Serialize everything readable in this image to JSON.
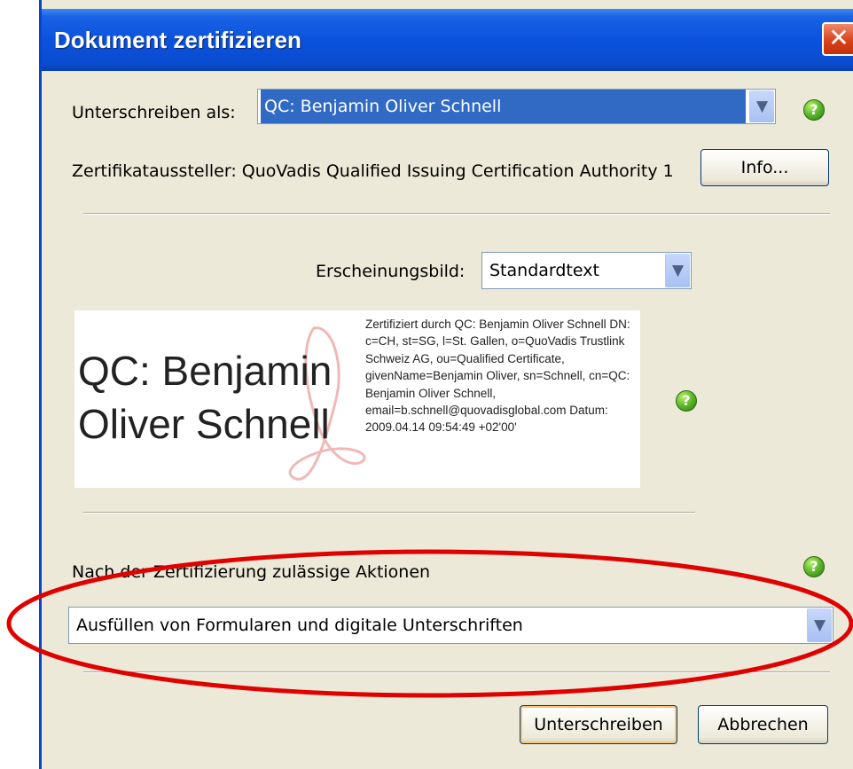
{
  "window": {
    "title": "Dokument zertifizieren",
    "close_glyph": "✕"
  },
  "sign_as": {
    "label": "Unterschreiben als:",
    "value": "QC: Benjamin Oliver Schnell"
  },
  "issuer": {
    "text": "Zertifikataussteller: QuoVadis Qualified Issuing Certification Authority 1",
    "info_label": "Info..."
  },
  "appearance": {
    "label": "Erscheinungsbild:",
    "value": "Standardtext"
  },
  "signature_preview": {
    "name_line1": "QC: Benjamin",
    "name_line2": "Oliver Schnell",
    "details": "Zertifiziert durch QC: Benjamin Oliver Schnell DN: c=CH, st=SG, l=St. Gallen, o=QuoVadis Trustlink Schweiz AG, ou=Qualified Certificate, givenName=Benjamin Oliver, sn=Schnell, cn=QC: Benjamin Oliver Schnell, email=b.schnell@quovadisglobal.com Datum: 2009.04.14 09:54:49 +02'00'"
  },
  "allowed_actions": {
    "label": "Nach der Zertifizierung zulässige Aktionen",
    "value": "Ausfüllen von Formularen und digitale Unterschriften"
  },
  "buttons": {
    "sign": "Unterschreiben",
    "cancel": "Abbrechen"
  },
  "icons": {
    "help": "help-icon",
    "dropdown": "chevron-down-icon",
    "close": "close-icon"
  },
  "colors": {
    "titlebar": "#0a52dc",
    "dialog_bg": "#ece9d8",
    "selection": "#316ac5",
    "help_green": "#5ab52a",
    "annotation": "#e00000"
  }
}
